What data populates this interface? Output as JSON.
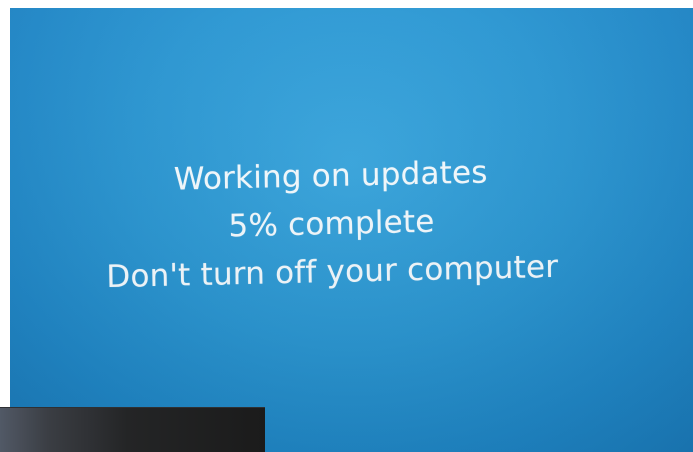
{
  "update": {
    "title": "Working on updates",
    "progress": "5% complete",
    "progress_value": 5,
    "warning": "Don't turn off your computer"
  },
  "colors": {
    "screen_blue": "#2a96d2",
    "text": "#f4fbff"
  }
}
